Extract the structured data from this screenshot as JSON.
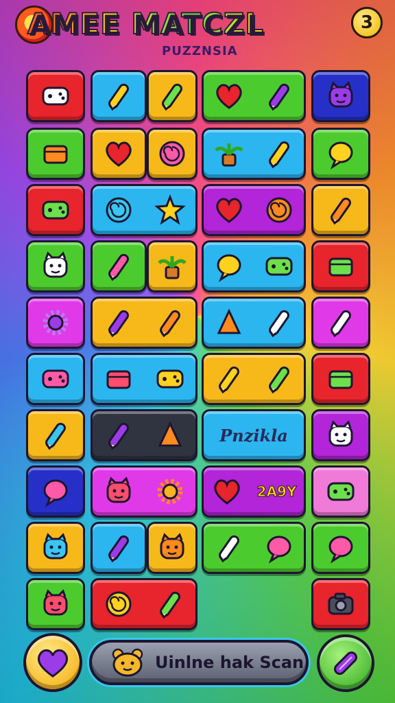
{
  "header": {
    "title": "AMEE MATCZL",
    "subtitle": "PUZZNSIA",
    "lives": "3"
  },
  "colors": {
    "red": "#e8242c",
    "blue": "#2bb6f0",
    "yellow": "#f7b81a",
    "green": "#4ccb2e",
    "navy": "#2630c8",
    "purple": "#b225d8",
    "magenta": "#e03ae8",
    "dark": "#2f3440",
    "pink": "#f07ad8"
  },
  "banner": {
    "label": "Pnzikla"
  },
  "tag": {
    "label": "2A9Y"
  },
  "footer": {
    "heart_button": "heart-icon",
    "action_label": "Uinlne hak Scan",
    "candy_button": "candy-icon"
  },
  "tiles": [
    {
      "name": "tile-dice",
      "color": "red",
      "icons": [
        "dice-icon"
      ]
    },
    {
      "name": "tile-pepper",
      "color": "blue",
      "icons": [
        "pepper-icon"
      ]
    },
    {
      "name": "tile-cherries",
      "color": "yellow",
      "icons": [
        "cherries-icon"
      ]
    },
    {
      "name": "tile-heart-brush",
      "color": "green",
      "icons": [
        "heart-icon",
        "brush-icon"
      ]
    },
    {
      "name": "tile-cat",
      "color": "navy",
      "icons": [
        "cat-face-icon"
      ]
    },
    {
      "name": "tile-battery",
      "color": "green",
      "icons": [
        "battery-icon"
      ]
    },
    {
      "name": "tile-heart",
      "color": "yellow",
      "icons": [
        "heart-icon"
      ]
    },
    {
      "name": "tile-bubble",
      "color": "yellow",
      "icons": [
        "bubble-icon"
      ]
    },
    {
      "name": "tile-leaf-strawberry",
      "color": "blue",
      "icons": [
        "leaf-icon",
        "strawberry-icon"
      ]
    },
    {
      "name": "tile-bulb",
      "color": "green",
      "icons": [
        "bulb-icon"
      ]
    },
    {
      "name": "tile-controller",
      "color": "red",
      "icons": [
        "gamepad-icon"
      ]
    },
    {
      "name": "tile-swirl-star",
      "color": "blue",
      "icons": [
        "swirl-icon",
        "star-icon"
      ]
    },
    {
      "name": "tile-heart-globe",
      "color": "purple",
      "icons": [
        "heart-icon",
        "globe-icon"
      ]
    },
    {
      "name": "tile-carrot",
      "color": "yellow",
      "icons": [
        "carrot-icon"
      ]
    },
    {
      "name": "tile-fox",
      "color": "green",
      "icons": [
        "fox-face-icon"
      ]
    },
    {
      "name": "tile-crayon",
      "color": "green",
      "icons": [
        "crayon-icon"
      ]
    },
    {
      "name": "tile-palm",
      "color": "yellow",
      "icons": [
        "palm-tree-icon"
      ]
    },
    {
      "name": "tile-lantern-pad",
      "color": "blue",
      "icons": [
        "lantern-icon",
        "gamepad-icon"
      ]
    },
    {
      "name": "tile-cheese",
      "color": "red",
      "icons": [
        "cheese-icon"
      ]
    },
    {
      "name": "tile-gear",
      "color": "magenta",
      "icons": [
        "gear-icon"
      ]
    },
    {
      "name": "tile-fruit-easel",
      "color": "yellow",
      "icons": [
        "fruit-icon",
        "easel-icon"
      ]
    },
    {
      "name": "tile-prism-wand",
      "color": "blue",
      "icons": [
        "prism-icon",
        "wand-icon"
      ]
    },
    {
      "name": "tile-pickle",
      "color": "magenta",
      "icons": [
        "pickle-icon"
      ]
    },
    {
      "name": "tile-joystick",
      "color": "blue",
      "icons": [
        "gamepad-icon"
      ]
    },
    {
      "name": "tile-chest-pad",
      "color": "blue",
      "icons": [
        "chest-icon",
        "gamepad-icon"
      ]
    },
    {
      "name": "tile-rocket-hook",
      "color": "yellow",
      "icons": [
        "rocket-icon",
        "hook-icon"
      ]
    },
    {
      "name": "tile-jar",
      "color": "red",
      "icons": [
        "jar-icon"
      ]
    },
    {
      "name": "tile-pencil",
      "color": "yellow",
      "icons": [
        "pencil-icon"
      ]
    },
    {
      "name": "tile-carrot-bolt",
      "color": "dark",
      "icons": [
        "carrot-icon",
        "bolt-icon"
      ]
    },
    {
      "name": "tile-banner",
      "color": "blue",
      "icons": []
    },
    {
      "name": "tile-bear",
      "color": "purple",
      "icons": [
        "bear-face-icon"
      ]
    },
    {
      "name": "tile-chat",
      "color": "navy",
      "icons": [
        "chat-icon"
      ]
    },
    {
      "name": "tile-monster-sun",
      "color": "magenta",
      "icons": [
        "monster-icon",
        "sun-icon"
      ]
    },
    {
      "name": "tile-heart-tag",
      "color": "purple",
      "icons": [
        "heart-icon"
      ]
    },
    {
      "name": "tile-bandage",
      "color": "pink",
      "icons": [
        "bandage-icon"
      ]
    },
    {
      "name": "tile-dog",
      "color": "yellow",
      "icons": [
        "dog-face-icon"
      ]
    },
    {
      "name": "tile-feather",
      "color": "blue",
      "icons": [
        "feather-icon"
      ]
    },
    {
      "name": "tile-bear-yellow",
      "color": "yellow",
      "icons": [
        "bear-face-icon"
      ]
    },
    {
      "name": "tile-kite-bulb",
      "color": "green",
      "icons": [
        "kite-icon",
        "bulb-icon"
      ]
    },
    {
      "name": "tile-blob",
      "color": "green",
      "icons": [
        "blob-icon"
      ]
    },
    {
      "name": "tile-pig",
      "color": "green",
      "icons": [
        "pig-face-icon"
      ]
    },
    {
      "name": "tile-swirl-fish",
      "color": "red",
      "icons": [
        "swirl-icon",
        "fish-icon"
      ]
    },
    {
      "name": "tile-camera",
      "color": "red",
      "icons": [
        "camera-icon"
      ]
    }
  ]
}
